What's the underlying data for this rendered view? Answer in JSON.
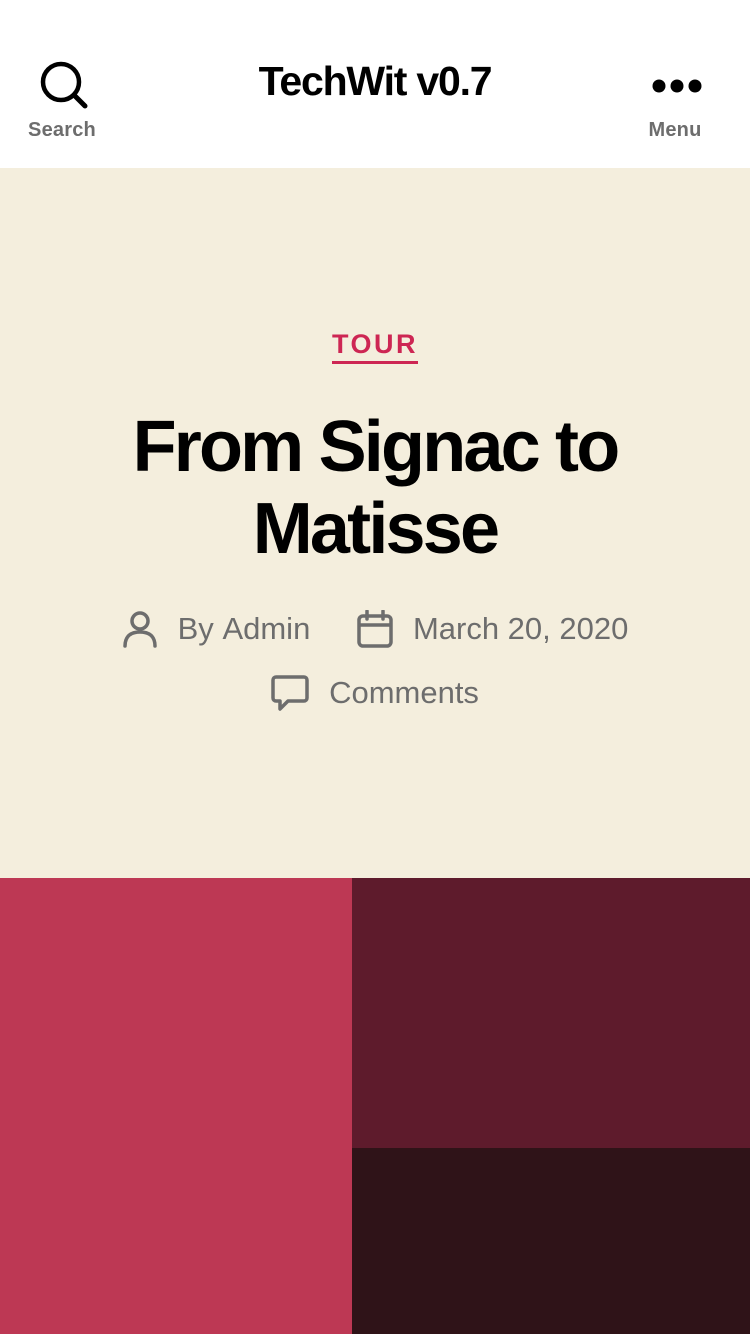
{
  "header": {
    "site_title": "TechWit v0.7",
    "search_label": "Search",
    "menu_label": "Menu",
    "search_icon": "search-icon",
    "menu_icon": "more-dots-icon"
  },
  "post": {
    "category": "TOUR",
    "title": "From Signac to Matisse",
    "author_prefix": "By",
    "author": "Admin",
    "date": "March 20, 2020",
    "comments": "Comments"
  },
  "colors": {
    "accent": "#cd2653",
    "hero_background": "#f4eedd",
    "meta_text": "#6d6d6d",
    "featured_pink": "#bd3854",
    "featured_maroon": "#5e1b2c",
    "featured_dark": "#2f1318"
  }
}
